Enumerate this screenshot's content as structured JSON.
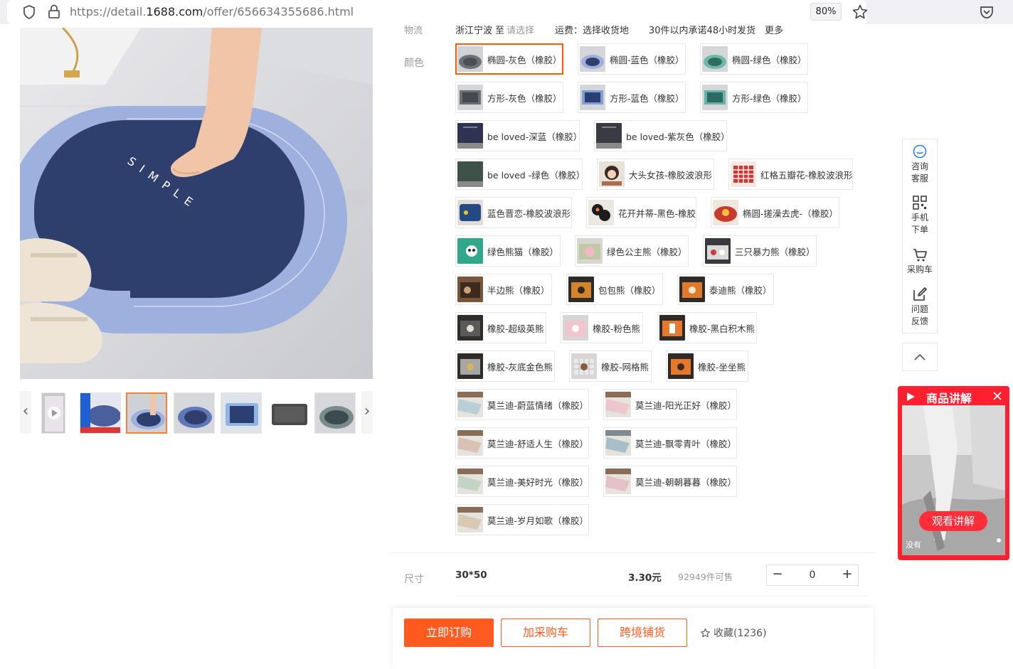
{
  "browser": {
    "url_prefix": "https://detail.",
    "url_domain": "1688.com",
    "url_path": "/offer/656634355686.html",
    "zoom": "80%"
  },
  "logistics_row": {
    "label": "物流",
    "from": "浙江宁波",
    "to_prefix": "至",
    "to_select": "请选择",
    "freight": "运费：选择收货地",
    "promise": "30件以内承诺48小时发货",
    "more": "更多"
  },
  "color": {
    "label": "颜色",
    "options": [
      {
        "label": "椭圆-灰色（橡胶）"
      },
      {
        "label": "椭圆-蓝色（橡胶）"
      },
      {
        "label": "椭圆-绿色（橡胶）"
      },
      {
        "label": "方形-灰色（橡胶）"
      },
      {
        "label": "方形-蓝色（橡胶）"
      },
      {
        "label": "方形-绿色（橡胶）"
      },
      {
        "label": "be loved-深蓝（橡胶）"
      },
      {
        "label": "be loved-紫灰色（橡胶）"
      },
      {
        "label": "be loved -绿色（橡胶）"
      },
      {
        "label": "大头女孩-橡胶波浪形"
      },
      {
        "label": "红格五瓣花-橡胶波浪形"
      },
      {
        "label": "蓝色晋恋-橡胶波浪形"
      },
      {
        "label": "花开并蒂-黑色-橡胶"
      },
      {
        "label": "椭圆-搓澡去虎-（橡胶）"
      },
      {
        "label": "绿色熊猫（橡胶）"
      },
      {
        "label": "绿色公主熊（橡胶）"
      },
      {
        "label": "三只暴力熊（橡胶）"
      },
      {
        "label": "半边熊（橡胶）"
      },
      {
        "label": "包包熊（橡胶）"
      },
      {
        "label": "泰迪熊（橡胶）"
      },
      {
        "label": "橡胶-超级英熊"
      },
      {
        "label": "橡胶-粉色熊"
      },
      {
        "label": "橡胶-黑白积木熊"
      },
      {
        "label": "橡胶-灰底金色熊"
      },
      {
        "label": "橡胶-网格熊"
      },
      {
        "label": "橡胶-坐坐熊"
      },
      {
        "label": "莫兰迪-蔚蓝情绪（橡胶）"
      },
      {
        "label": "莫兰迪-阳光正好（橡胶）"
      },
      {
        "label": "莫兰迪-舒适人生（橡胶）"
      },
      {
        "label": "莫兰迪-飘零青叶（橡胶）"
      },
      {
        "label": "莫兰迪-美好时光（橡胶）"
      },
      {
        "label": "莫兰迪-朝朝暮暮（橡胶）"
      },
      {
        "label": "莫兰迪-岁月如歌（橡胶）"
      }
    ]
  },
  "size": {
    "label": "尺寸",
    "value": "30*50",
    "price": "3.30元",
    "stock": "92949件可售",
    "quantity": "0",
    "minus": "−",
    "plus": "+"
  },
  "actions": {
    "buy_now": "立即订购",
    "add_cart": "加采购车",
    "cross_border": "跨境铺货",
    "favorite": "收藏(1236)"
  },
  "tools": {
    "consult_line1": "咨询",
    "consult_line2": "客服",
    "mobile_line1": "手机",
    "mobile_line2": "下单",
    "cart": "采购车",
    "feedback_line1": "问题",
    "feedback_line2": "反馈"
  },
  "live": {
    "title": "商品讲解",
    "watch": "观看讲解",
    "no_label": "没有"
  },
  "product_image": {
    "brand_text": "SIMPLE"
  }
}
